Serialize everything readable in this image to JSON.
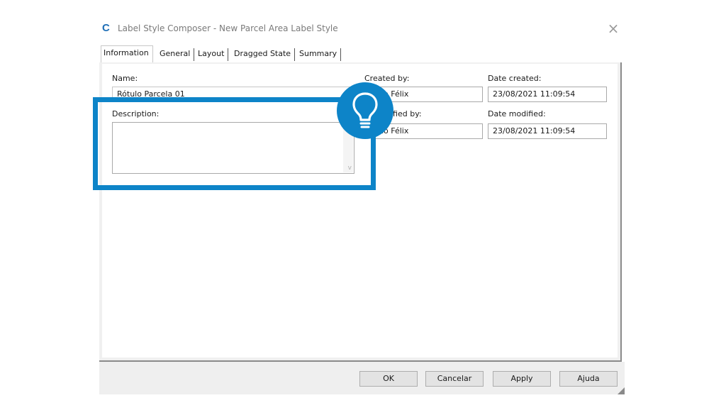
{
  "window": {
    "title": "Label Style Composer - New Parcel Area Label Style",
    "app_icon_glyph": "C",
    "close_glyph": "×"
  },
  "tabs": [
    {
      "label": "Information",
      "active": true
    },
    {
      "label": "General",
      "active": false
    },
    {
      "label": "Layout",
      "active": false
    },
    {
      "label": "Dragged State",
      "active": false
    },
    {
      "label": "Summary",
      "active": false
    }
  ],
  "form": {
    "name_label": "Name:",
    "name_value": "Rótulo Parcela 01",
    "description_label": "Description:",
    "description_value": "",
    "created_by_label": "Created by:",
    "created_by_value": "nio Félix",
    "date_created_label": "Date created:",
    "date_created_value": "23/08/2021 11:09:54",
    "modified_by_label": "dified by:",
    "modified_by_value": "nio Félix",
    "date_modified_label": "Date modified:",
    "date_modified_value": "23/08/2021 11:09:54"
  },
  "buttons": {
    "ok": "OK",
    "cancel": "Cancelar",
    "apply": "Apply",
    "help": "Ajuda"
  },
  "overlay": {
    "accent_color": "#0d84c8",
    "icon": "lightbulb-icon"
  },
  "scroll_down_glyph": "v"
}
